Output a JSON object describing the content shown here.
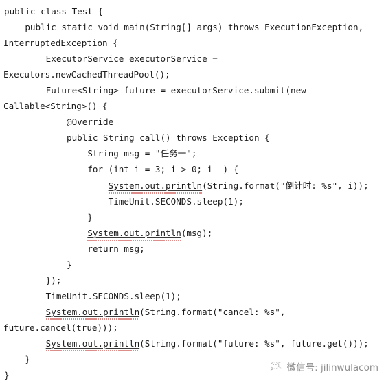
{
  "document": {
    "language": "Java",
    "kind": "code-screenshot",
    "background_color": "#ffffff",
    "text_color": "#1b1b1b",
    "squiggle_color": "#d4716d"
  },
  "code": {
    "lines": [
      {
        "text": "public class Test {",
        "wrapped": false
      },
      {
        "text": "    public static void main(String[] args) throws ExecutionException,",
        "wrapped": false
      },
      {
        "text": "InterruptedException {",
        "wrapped": true
      },
      {
        "text": "        ExecutorService executorService =",
        "wrapped": false
      },
      {
        "text": "Executors.newCachedThreadPool();",
        "wrapped": true
      },
      {
        "text": "        Future<String> future = executorService.submit(new",
        "wrapped": false
      },
      {
        "text": "Callable<String>() {",
        "wrapped": true
      },
      {
        "text": "            @Override",
        "wrapped": false
      },
      {
        "text": "            public String call() throws Exception {",
        "wrapped": false
      },
      {
        "text": "                String msg = \"任务一\";",
        "wrapped": false
      },
      {
        "text": "                for (int i = 3; i > 0; i--) {",
        "wrapped": false
      },
      {
        "text": "                    System.out.println(String.format(\"倒计时: %s\", i));",
        "wrapped": false,
        "squiggle": "System.out.println"
      },
      {
        "text": "                    TimeUnit.SECONDS.sleep(1);",
        "wrapped": false
      },
      {
        "text": "                }",
        "wrapped": false
      },
      {
        "text": "                System.out.println(msg);",
        "wrapped": false,
        "squiggle": "System.out.println"
      },
      {
        "text": "                return msg;",
        "wrapped": false
      },
      {
        "text": "            }",
        "wrapped": false
      },
      {
        "text": "        });",
        "wrapped": false
      },
      {
        "text": "        TimeUnit.SECONDS.sleep(1);",
        "wrapped": false
      },
      {
        "text": "        System.out.println(String.format(\"cancel: %s\",",
        "wrapped": false,
        "squiggle": "System.out.println"
      },
      {
        "text": "future.cancel(true)));",
        "wrapped": true
      },
      {
        "text": "        System.out.println(String.format(\"future: %s\", future.get()));",
        "wrapped": false,
        "squiggle": "System.out.println"
      },
      {
        "text": "    }",
        "wrapped": false
      },
      {
        "text": "}",
        "wrapped": false
      }
    ]
  },
  "watermark": {
    "icon": "wechat-icon",
    "label": "微信号: jilinwulacom"
  }
}
